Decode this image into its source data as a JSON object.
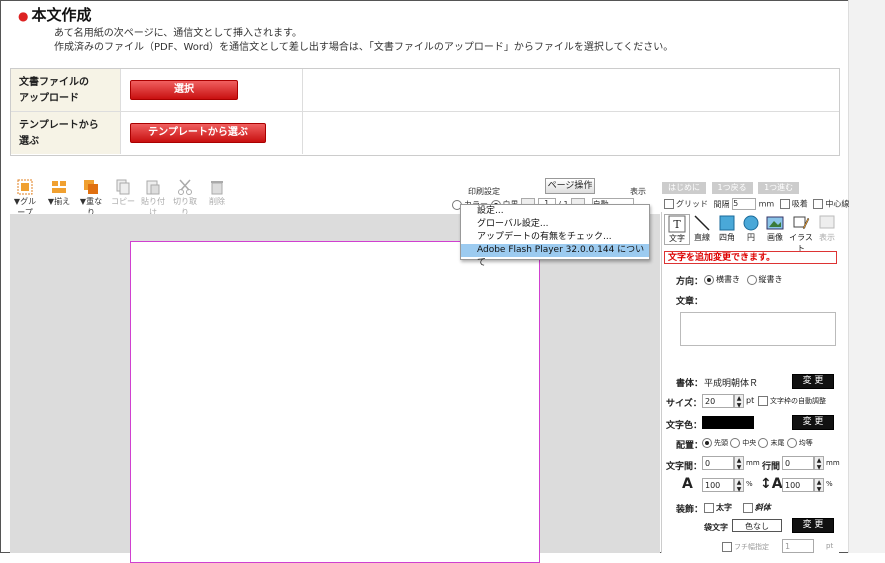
{
  "header": {
    "title": "本文作成",
    "desc1": "あて名用紙の次ページに、通信文として挿入されます。",
    "desc2": "作成済みのファイル（PDF、Word）を通信文として差し出す場合は、「文書ファイルのアップロード」からファイルを選択してください。"
  },
  "upload": {
    "row1_label": "文書ファイルの\nアップロード",
    "row1_btn": "選択",
    "row2_label": "テンプレートから\n選ぶ",
    "row2_btn": "テンプレートから選ぶ"
  },
  "toolbar": {
    "group": "▼グループ",
    "align": "▼揃え",
    "overlap": "▼重なり",
    "copy": "コピー",
    "paste": "貼り付け",
    "cut": "切り取り",
    "delete": "削除",
    "print_setting": "印刷設定",
    "page_op": "ページ操作",
    "display": "表示",
    "color": "カラー",
    "mono": "白黒",
    "page_cur": "1",
    "page_sep": "/",
    "page_total": "1",
    "zoom": "自動",
    "nav_first": "はじめに",
    "nav_back": "1つ戻る",
    "nav_next": "1つ進む",
    "grid": "グリッド",
    "interval": "間隔",
    "interval_val": "5",
    "unit_mm": "mm",
    "snap": "吸着",
    "center": "中心線"
  },
  "context_menu": {
    "items": [
      "設定...",
      "グローバル設定...",
      "アップデートの有無をチェック...",
      "Adobe Flash Player 32.0.0.144 について"
    ]
  },
  "panel": {
    "tabs": [
      "文字",
      "直線",
      "四角",
      "円",
      "画像",
      "イラスト",
      "表示"
    ],
    "notice": "文字を追加変更できます。",
    "direction_label": "方向：",
    "dir_h": "横書き",
    "dir_v": "縦書き",
    "text_label": "文章：",
    "font_label": "書体：",
    "font_value": "平成明朝体Ｒ",
    "change": "変 更",
    "size_label": "サイズ：",
    "size_value": "20",
    "size_unit": "pt",
    "auto_fit": "文字枠の自動調整",
    "color_label": "文字色：",
    "align_label": "配置：",
    "align_start": "先頭",
    "align_center": "中央",
    "align_end": "末尾",
    "align_even": "均等",
    "char_space_label": "文字間：",
    "char_space_value": "0",
    "line_space_label": "行間",
    "line_space_value": "0",
    "unit_mm": "mm",
    "scale_h": "100",
    "scale_v": "100",
    "pct": "%",
    "deco_label": "装飾：",
    "bold": "太字",
    "italic": "斜体",
    "outline_label": "袋文字",
    "outline_value": "色なし",
    "edge_label": "フチ幅指定",
    "edge_value": "1",
    "edge_unit": "pt"
  }
}
